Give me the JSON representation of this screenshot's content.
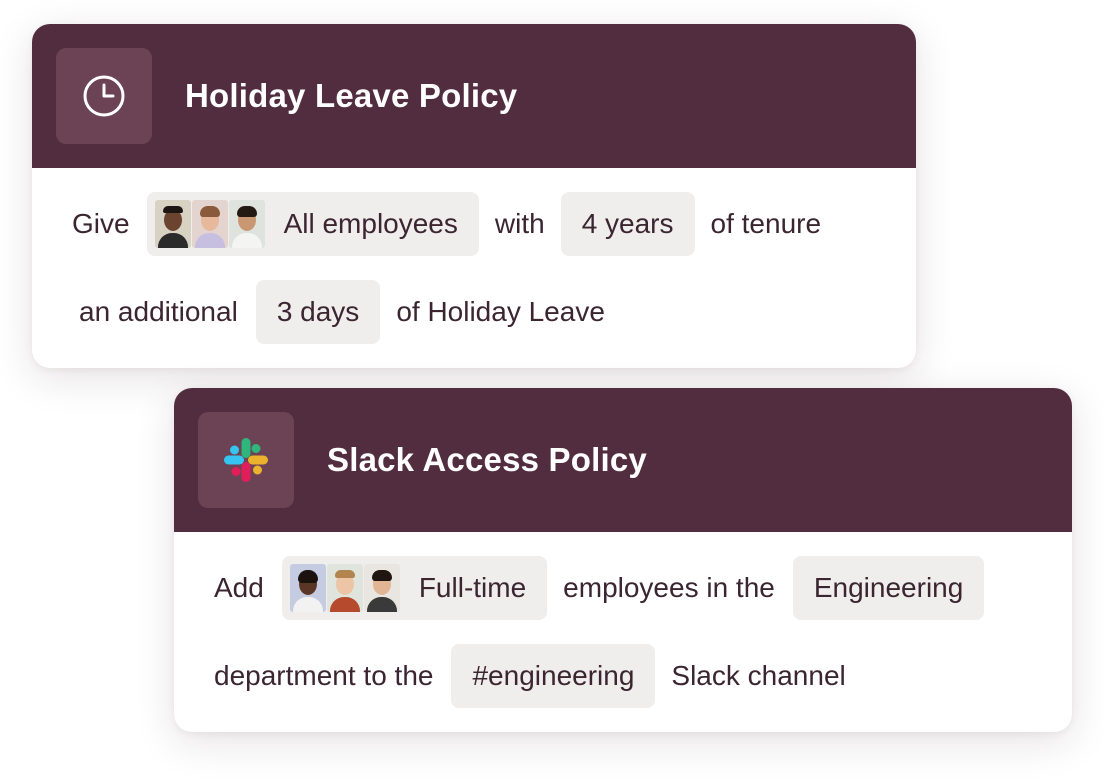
{
  "cards": [
    {
      "title": "Holiday Leave Policy",
      "icon": "clock-icon",
      "line1": {
        "prefix": "Give",
        "audience_chip": "All employees",
        "connector": "with",
        "tenure_chip": "4 years",
        "suffix": "of tenure"
      },
      "line2": {
        "prefix": "an additional",
        "days_chip": "3 days",
        "suffix": "of Holiday Leave"
      }
    },
    {
      "title": "Slack Access Policy",
      "icon": "slack-icon",
      "line1": {
        "prefix": "Add",
        "audience_chip": "Full-time",
        "connector": "employees in the",
        "department_chip": "Engineering"
      },
      "line2": {
        "prefix": "department to the",
        "channel_chip": "#engineering",
        "suffix": "Slack channel"
      }
    }
  ],
  "colors": {
    "header_bg": "#522d3f",
    "icon_tile_bg": "#6b4354",
    "chip_bg": "#f0eded",
    "text": "#3a2530"
  }
}
